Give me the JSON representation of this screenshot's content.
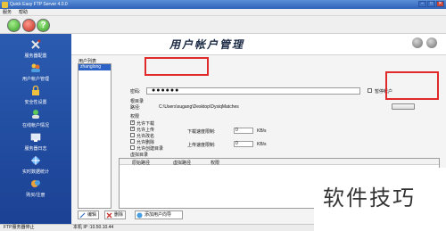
{
  "window": {
    "title": "Quick Easy FTP Server 4.0.0"
  },
  "menu": [
    "服务",
    "帮助"
  ],
  "toolbar": {
    "help_glyph": "?"
  },
  "sidebar": {
    "items": [
      {
        "label": "服务器配置",
        "icon": "tools-icon"
      },
      {
        "label": "用户帐户管理",
        "icon": "users-icon"
      },
      {
        "label": "安全性设置",
        "icon": "lock-icon"
      },
      {
        "label": "在线帐户情况",
        "icon": "online-users-icon"
      },
      {
        "label": "服务器日志",
        "icon": "log-icon"
      },
      {
        "label": "实时数据统计",
        "icon": "stats-icon"
      },
      {
        "label": "购买/注册",
        "icon": "register-icon"
      }
    ]
  },
  "header": {
    "title": "用户帐户管理"
  },
  "user_list": {
    "caption": "用户列表",
    "users": [
      "zhanglong"
    ]
  },
  "details": {
    "password_label": "密码:",
    "password_value": "●●●●●●",
    "disable_label": "暂停帐户",
    "root_label_1": "根目录",
    "root_label_2": "路径:",
    "root_path": "C:\\Users\\sugang\\Desktop\\DysiqMatches",
    "perm_label": "权限",
    "permissions": [
      {
        "label": "允许下载",
        "checked": true
      },
      {
        "label": "允许上传",
        "checked": true
      },
      {
        "label": "允许改名",
        "checked": false
      },
      {
        "label": "允许删除",
        "checked": false
      },
      {
        "label": "允许创建目录",
        "checked": false
      }
    ],
    "download_label": "下载速度限制:",
    "download_value": "0",
    "upload_label": "上传速度限制:",
    "upload_value": "0",
    "speed_unit": "KB/s",
    "virtual_label": "虚拟目录",
    "virtual_columns": [
      "原始路径",
      "虚拟路径",
      "权限"
    ]
  },
  "buttons": {
    "edit": "编辑",
    "delete": "删除",
    "add_user": "添加用户向导"
  },
  "status": {
    "left": "FTP服务器停止",
    "ip": "本机 IP :10.50.10.44"
  },
  "watermark": "软件技巧",
  "colors": {
    "sidebar": "#1f4aa0",
    "selection": "#2c62c5",
    "annotation": "#e02a2a"
  }
}
